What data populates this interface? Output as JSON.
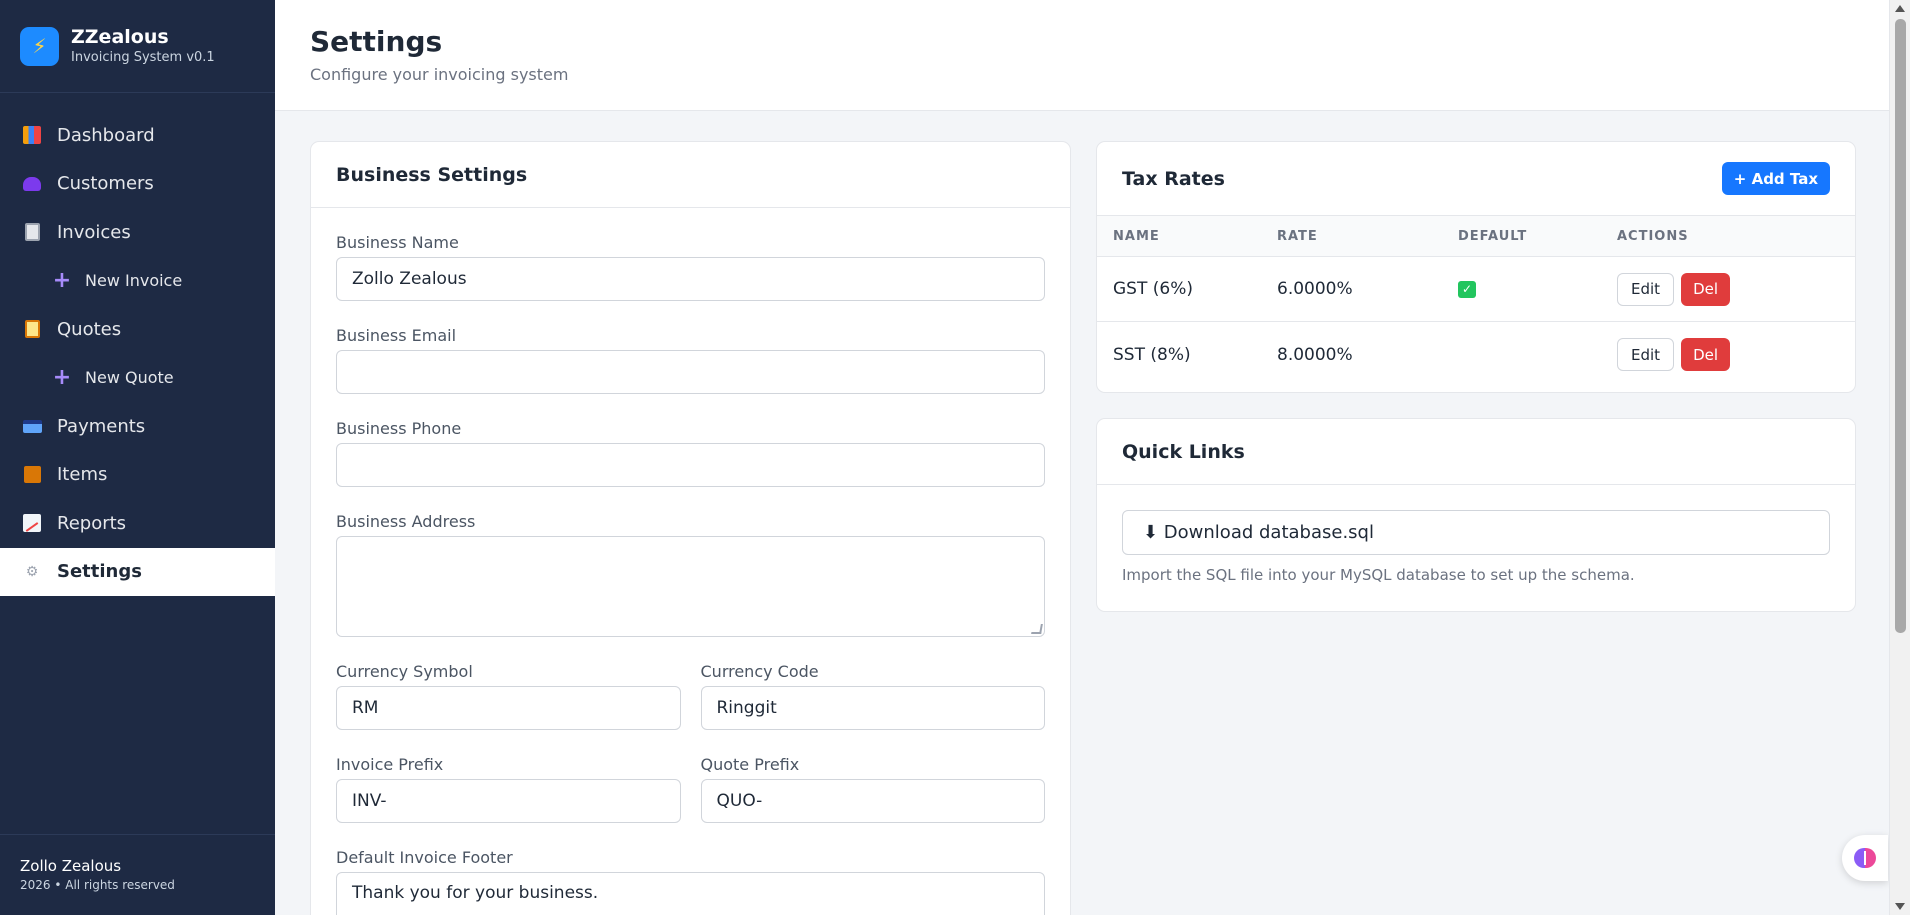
{
  "brand": {
    "name": "ZZealous",
    "subtitle": "Invoicing System v0.1",
    "logo_icon": "lightning-icon"
  },
  "nav": {
    "dashboard": "Dashboard",
    "customers": "Customers",
    "invoices": "Invoices",
    "new_invoice": "New Invoice",
    "quotes": "Quotes",
    "new_quote": "New Quote",
    "payments": "Payments",
    "items": "Items",
    "reports": "Reports",
    "settings": "Settings",
    "active": "settings"
  },
  "footer": {
    "name": "Zollo Zealous",
    "copyright": "2026 • All rights reserved"
  },
  "header": {
    "title": "Settings",
    "subtitle": "Configure your invoicing system"
  },
  "business": {
    "title": "Business Settings",
    "name_label": "Business Name",
    "name_value": "Zollo Zealous",
    "email_label": "Business Email",
    "email_value": "",
    "phone_label": "Business Phone",
    "phone_value": "",
    "address_label": "Business Address",
    "address_value": "",
    "currency_symbol_label": "Currency Symbol",
    "currency_symbol_value": "RM",
    "currency_code_label": "Currency Code",
    "currency_code_value": "Ringgit",
    "invoice_prefix_label": "Invoice Prefix",
    "invoice_prefix_value": "INV-",
    "quote_prefix_label": "Quote Prefix",
    "quote_prefix_value": "QUO-",
    "footer_label": "Default Invoice Footer",
    "footer_value": "Thank you for your business."
  },
  "tax": {
    "title": "Tax Rates",
    "add_label": "+ Add Tax",
    "columns": [
      "NAME",
      "RATE",
      "DEFAULT",
      "ACTIONS"
    ],
    "rows": [
      {
        "name": "GST (6%)",
        "rate": "6.0000%",
        "default": true
      },
      {
        "name": "SST (8%)",
        "rate": "8.0000%",
        "default": false
      }
    ],
    "edit_label": "Edit",
    "delete_label": "Del"
  },
  "links": {
    "title": "Quick Links",
    "download_label": "⬇ Download database.sql",
    "hint": "Import the SQL file into your MySQL database to set up the schema."
  },
  "colors": {
    "sidebar": "#1e2a44",
    "primary": "#1677ff",
    "danger": "#e03c3c",
    "success": "#22c55e"
  }
}
